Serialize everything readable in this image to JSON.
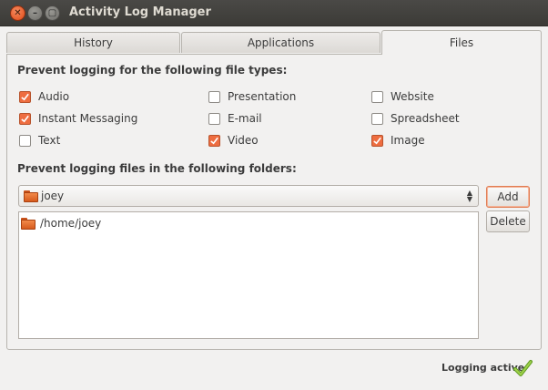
{
  "window": {
    "title": "Activity Log Manager"
  },
  "tabs": [
    {
      "label": "History"
    },
    {
      "label": "Applications"
    },
    {
      "label": "Files",
      "active": true
    }
  ],
  "files": {
    "file_types_heading": "Prevent logging for the following file types:",
    "file_types": [
      {
        "label": "Audio",
        "checked": true
      },
      {
        "label": "Presentation",
        "checked": false
      },
      {
        "label": "Website",
        "checked": false
      },
      {
        "label": "Instant Messaging",
        "checked": true
      },
      {
        "label": "E-mail",
        "checked": false
      },
      {
        "label": "Spreadsheet",
        "checked": false
      },
      {
        "label": "Text",
        "checked": false
      },
      {
        "label": "Video",
        "checked": true
      },
      {
        "label": "Image",
        "checked": true
      }
    ],
    "folders_heading": "Prevent logging files in the following folders:",
    "folder_combo": {
      "value": "joey",
      "icon": "folder-icon"
    },
    "folders": [
      {
        "path": "/home/joey",
        "icon": "folder-icon"
      }
    ],
    "add_label": "Add",
    "delete_label": "Delete"
  },
  "status": {
    "text": "Logging active",
    "icon": "checkmark-icon"
  },
  "colors": {
    "accent": "#ee6d40",
    "titlebar": "#3c3b37",
    "check_green": "#7fb832"
  }
}
